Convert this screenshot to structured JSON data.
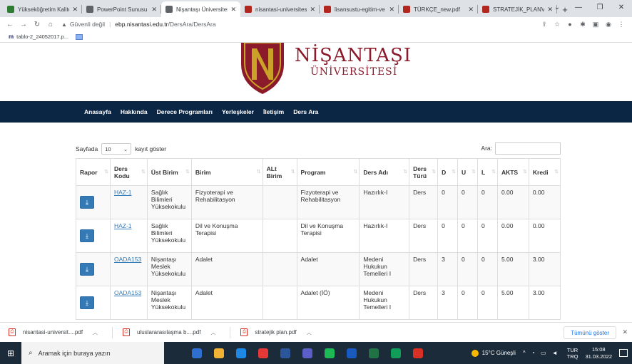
{
  "browser": {
    "tabs": [
      {
        "title": "Yükseköğretim Kalite",
        "color": "#2e7d32",
        "active": false
      },
      {
        "title": "PowerPoint Sunusu",
        "color": "#5f6368",
        "active": false
      },
      {
        "title": "Nişantaşı Üniversitesi",
        "color": "#5f6368",
        "active": true
      },
      {
        "title": "nisantasi-universitesi",
        "color": "#b3261e",
        "active": false
      },
      {
        "title": "lisansustu-egitim-ve",
        "color": "#b3261e",
        "active": false
      },
      {
        "title": "TÜRKÇE_new.pdf",
        "color": "#b3261e",
        "active": false
      },
      {
        "title": "STRATEJİK_PLANV5.p",
        "color": "#b3261e",
        "active": false
      }
    ],
    "tab_close": "✕",
    "new_tab": "+",
    "address": {
      "security_label": "Güvenli değil",
      "host": "ebp.nisantasi.edu.tr",
      "path": "/DersAra/DersAra"
    },
    "bookmark": {
      "icon_text": "m",
      "label": "tablo-2_24052017.p..."
    }
  },
  "site": {
    "logo": {
      "line1": "NİŞANTAŞI",
      "line2": "ÜNİVERSİTESİ"
    },
    "nav": [
      "Anasayfa",
      "Hakkında",
      "Derece Programları",
      "Yerleşkeler",
      "İletişim",
      "Ders Ara"
    ],
    "length_prefix": "Sayfada",
    "length_value": "10",
    "length_suffix": "kayıt göster",
    "search_label": "Ara:"
  },
  "table": {
    "columns": [
      "Rapor",
      "Ders Kodu",
      "Üst Birim",
      "Birim",
      "ALt Birim",
      "Program",
      "Ders Adı",
      "Ders Türü",
      "D",
      "U",
      "L",
      "AKTS",
      "Kredi"
    ],
    "rows": [
      {
        "code": "HAZ-1",
        "ust": "Sağlık Bilimleri Yüksekokulu",
        "birim": "Fizyoterapi ve Rehabilitasyon",
        "alt": "",
        "program": "Fizyoterapi ve Rehabilitasyon",
        "ders": "Hazırlık-I",
        "tur": "Ders",
        "d": "0",
        "u": "0",
        "l": "0",
        "akts": "0.00",
        "kredi": "0.00"
      },
      {
        "code": "HAZ-1",
        "ust": "Sağlık Bilimleri Yüksekokulu",
        "birim": "Dil ve Konuşma Terapisi",
        "alt": "",
        "program": "Dil ve Konuşma Terapisi",
        "ders": "Hazırlık-I",
        "tur": "Ders",
        "d": "0",
        "u": "0",
        "l": "0",
        "akts": "0.00",
        "kredi": "0.00"
      },
      {
        "code": "OADA153",
        "ust": "Nişantaşı Meslek Yüksekokulu",
        "birim": "Adalet",
        "alt": "",
        "program": "Adalet",
        "ders": "Medeni Hukukun Temelleri I",
        "tur": "Ders",
        "d": "3",
        "u": "0",
        "l": "0",
        "akts": "5.00",
        "kredi": "3.00"
      },
      {
        "code": "OADA153",
        "ust": "Nişantaşı Meslek Yüksekokulu",
        "birim": "Adalet",
        "alt": "",
        "program": "Adalet (İÖ)",
        "ders": "Medeni Hukukun Temelleri I",
        "tur": "Ders",
        "d": "3",
        "u": "0",
        "l": "0",
        "akts": "5.00",
        "kredi": "3.00"
      }
    ]
  },
  "downloads": {
    "items": [
      "nisantasi-universit....pdf",
      "uluslararasılaşma b....pdf",
      "stratejik plan.pdf"
    ],
    "show_all": "Tümünü göster"
  },
  "taskbar": {
    "search_placeholder": "Aramak için buraya yazın",
    "apps": [
      "#2f6fd1",
      "#f2b233",
      "#1e88e5",
      "#e53935",
      "#2b579a",
      "#5b5fc7",
      "#1db954",
      "#185abd",
      "#217346",
      "#0f9d58",
      "#d93025"
    ],
    "weather": "15°C  Güneşli",
    "lang1": "TUR",
    "lang2": "TRQ",
    "time": "15:08",
    "date": "31.03.2022"
  },
  "colors": {
    "navbar": "#0b2545",
    "brand": "#8b1a2b",
    "button": "#337ab7"
  }
}
